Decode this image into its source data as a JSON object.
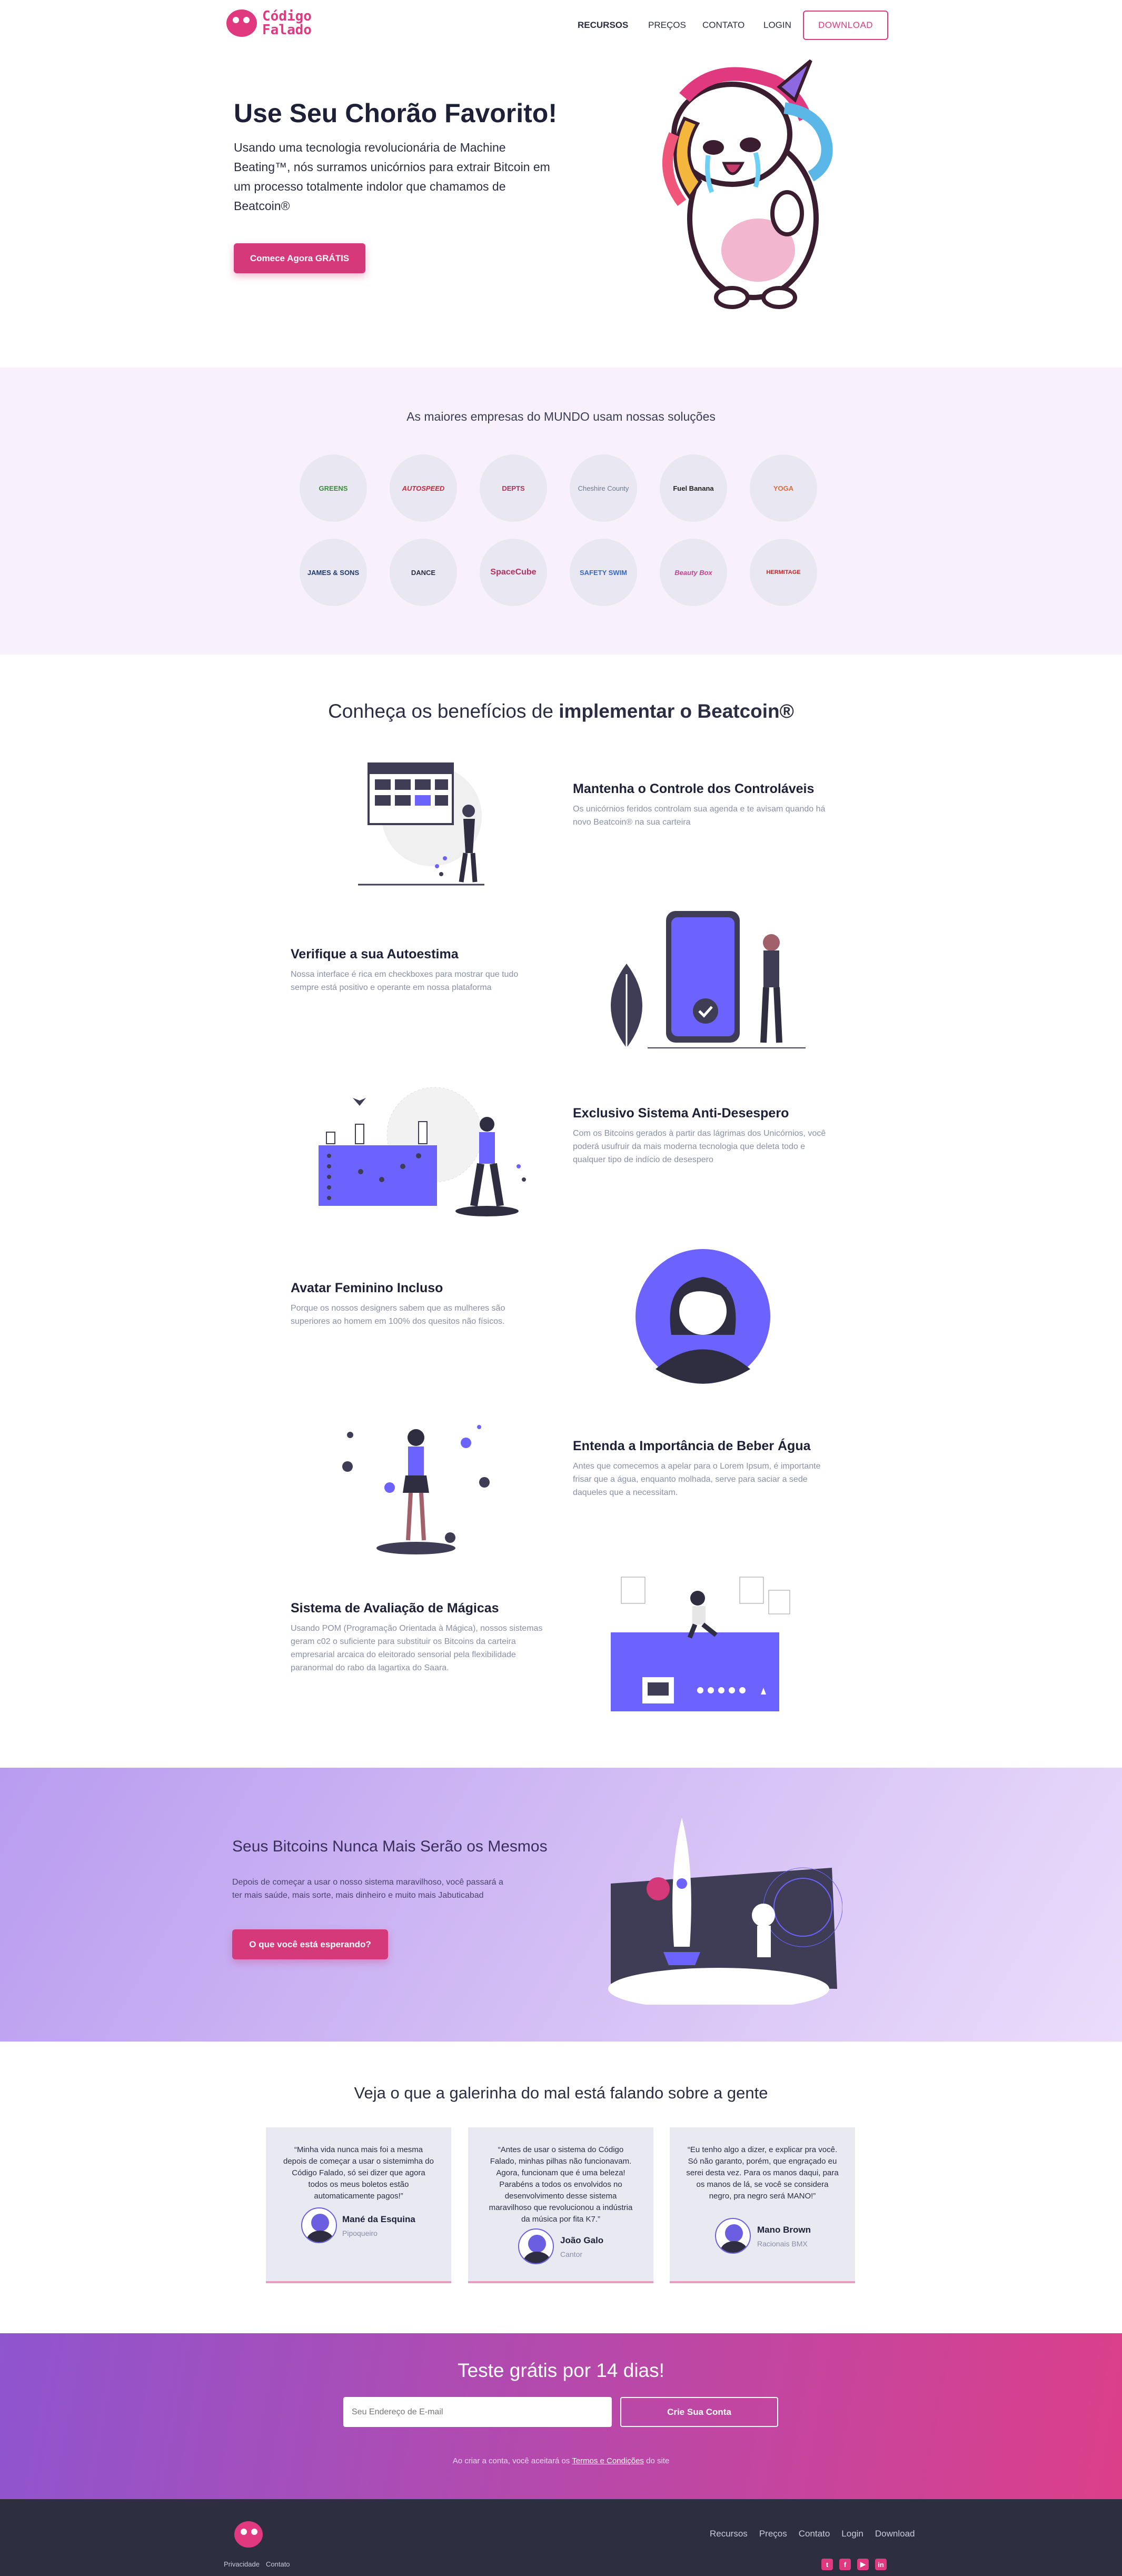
{
  "brand": {
    "logo_text_line1": "Código",
    "logo_text_line2": "Falado"
  },
  "nav": {
    "items": [
      "RECURSOS",
      "PREÇOS",
      "CONTATO",
      "LOGIN"
    ],
    "download": "DOWNLOAD"
  },
  "hero": {
    "title": "Use Seu Chorão Favorito!",
    "text": "Usando uma tecnologia revolucionária de Machine Beating™, nós surramos unicórnios para extrair Bitcoin em um processo totalmente indolor que chamamos de Beatcoin®",
    "cta": "Comece Agora GRÁTIS"
  },
  "clients": {
    "title": "As maiores empresas do MUNDO usam nossas soluções",
    "logos": [
      "GREENS",
      "AUTOSPEED",
      "DEPTS",
      "Cheshire County",
      "Fuel Banana",
      "YOGA",
      "JAMES & SONS",
      "DANCE",
      "SpaceCube",
      "SAFETY SWIM",
      "Beauty Box",
      "HERMITAGE"
    ]
  },
  "benefits": {
    "title_prefix": "Conheça os benefícios de ",
    "title_bold": "implementar o Beatcoin®",
    "items": [
      {
        "title": "Mantenha o Controle dos Controláveis",
        "text": "Os unicórnios feridos controlam sua agenda e te avisam quando há novo Beatcoin® na sua carteira"
      },
      {
        "title": "Verifique a sua Autoestima",
        "text": "Nossa interface é rica em checkboxes para mostrar que tudo sempre está positivo e operante em nossa plataforma"
      },
      {
        "title": "Exclusivo Sistema Anti-Desespero",
        "text": "Com os Bitcoins gerados à partir das lágrimas dos Unicórnios, você poderá usufruir da mais moderna tecnologia que deleta todo e qualquer tipo de indício de desespero"
      },
      {
        "title": "Avatar Feminino Incluso",
        "text": "Porque os nossos designers sabem que as mulheres são superiores ao homem em 100% dos quesitos não físicos."
      },
      {
        "title": "Entenda a Importância de Beber Água",
        "text": "Antes que comecemos a apelar para o Lorem Ipsum, é importante frisar que a água, enquanto molhada, serve para saciar a sede daqueles que a necessitam."
      },
      {
        "title": "Sistema de Avaliação de Mágicas",
        "text": "Usando POM (Programação Orientada à Mágica), nossos sistemas geram c02 o suficiente para substituir os Bitcoins da carteira empresarial arcaica do eleitorado sensorial pela flexibilidade paranormal do rabo da lagartixa do Saara."
      }
    ]
  },
  "promo": {
    "title": "Seus Bitcoins Nunca Mais Serão os Mesmos",
    "text": "Depois de começar a usar o nosso sistema maravilhoso, você passará a ter mais saúde, mais sorte, mais dinheiro e muito mais Jabuticabad",
    "cta": "O que você está esperando?"
  },
  "testimonials": {
    "title": "Veja o que a galerinha do mal está falando sobre a gente",
    "items": [
      {
        "quote": "“Minha vida nunca mais foi a mesma depois de começar a usar o sistemimha do Código Falado, só sei dizer que agora todos os meus boletos estão automaticamente pagos!”",
        "name": "Mané da Esquina",
        "role": "Pipoqueiro"
      },
      {
        "quote": "“Antes de usar o sistema do Código Falado, minhas pilhas não funcionavam. Agora, funcionam que é uma beleza! Parabéns a todos os envolvidos no desenvolvimento desse sistema maravilhoso que revolucionou a indústria da música por fita K7.”",
        "name": "João Galo",
        "role": "Cantor"
      },
      {
        "quote": "“Eu tenho algo a dizer, e explicar pra você. Só não garanto, porém, que engraçado eu serei desta vez. Para os manos daqui, para os manos de lá, se você se considera negro, pra negro será MANO!”",
        "name": "Mano Brown",
        "role": "Racionais BMX"
      }
    ]
  },
  "cta": {
    "title": "Teste grátis por 14 dias!",
    "email_placeholder": "Seu Endereço de E-mail",
    "button": "Crie Sua Conta",
    "terms_prefix": "Ao criar a conta, você aceitará os ",
    "terms_link": "Termos e Condições",
    "terms_suffix": " do site"
  },
  "footer": {
    "links": [
      "Recursos",
      "Preços",
      "Contato",
      "Login",
      "Download"
    ],
    "bottom_links": [
      "Privacidade",
      "Contato"
    ],
    "social_icons": [
      "twitter-icon",
      "facebook-icon",
      "youtube-icon",
      "linkedin-icon"
    ]
  },
  "colors": {
    "brand_pink": "#e0397f",
    "purple": "#6c5ee0",
    "dark": "#2d2f41"
  }
}
